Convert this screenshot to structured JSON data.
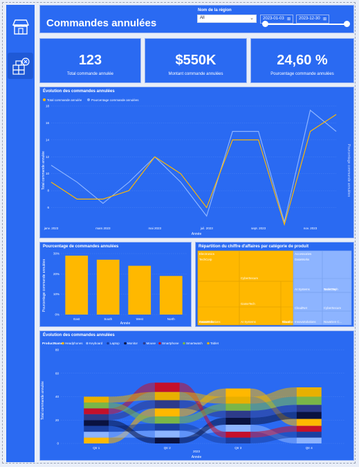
{
  "header": {
    "title": "Commandes annulées",
    "region_label": "Nom de la région",
    "region_value": "All",
    "date_start": "2023-01-03",
    "date_end": "2023-12-30"
  },
  "kpis": [
    {
      "value": "123",
      "label": "Total commande annulée"
    },
    {
      "value": "$550K",
      "label": "Montant commande annulées"
    },
    {
      "value": "24,60 %",
      "label": "Pourcentage commande annulées"
    }
  ],
  "colors": {
    "accent": "#2a6af2",
    "orange": "#ffb800",
    "light_blue": "#8db4ff"
  },
  "sidebar": {
    "icons": [
      "store-icon",
      "cancelled-boxes-icon"
    ]
  },
  "charts": {
    "line": {
      "title": "Évolution des commandes annulées",
      "legend": [
        "Total commande annulée",
        "Pourcentage commande annulées"
      ],
      "ylabel": "Total commande annulée",
      "y2label": "Pourcentage commande annulées",
      "xlabel": "Année",
      "ticks_x": [
        "janv. 2023",
        "mars 2023",
        "mai 2023",
        "juil. 2023",
        "sept. 2023",
        "nov. 2023"
      ],
      "ticks_y": [
        "6",
        "8",
        "10",
        "12",
        "14",
        "16",
        "18"
      ]
    },
    "bar": {
      "title": "Pourcentage de commandes annulées",
      "ylabel": "Pourcentage commande annulées",
      "xlabel": "Année",
      "ticks_y": [
        "0%",
        "10%",
        "20%",
        "30%"
      ]
    },
    "treemap": {
      "title": "Répartition du chiffre d'affaires par catégorie de produit"
    },
    "sankey": {
      "title": "Évolution des commandes annulées",
      "legend_label": "ProductName",
      "ylabel": "Total commande annulée",
      "xlabel": "Année",
      "year": "2023",
      "ticks_y": [
        "0",
        "20",
        "40",
        "60",
        "80"
      ],
      "quarters": [
        "Qtr 1",
        "Qtr 2",
        "Qtr 3",
        "Qtr 4"
      ]
    }
  },
  "chart_data": [
    {
      "type": "line",
      "title": "Évolution des commandes annulées",
      "xlabel": "Année",
      "ylabel": "Total commande annulée",
      "x": [
        "janv. 2023",
        "févr. 2023",
        "mars 2023",
        "avr. 2023",
        "mai 2023",
        "juin 2023",
        "juil. 2023",
        "août 2023",
        "sept. 2023",
        "oct. 2023",
        "nov. 2023",
        "déc. 2023"
      ],
      "ylim": [
        4,
        18
      ],
      "series": [
        {
          "name": "Total commande annulée",
          "color": "#ffb800",
          "values": [
            9,
            7,
            7,
            8,
            12,
            10,
            6,
            14,
            14,
            4,
            15,
            17
          ]
        },
        {
          "name": "Pourcentage commande annulées",
          "color": "#8db4ff",
          "values": [
            11,
            9,
            6.5,
            9,
            12,
            9,
            5,
            15,
            15,
            4.3,
            17.5,
            15
          ]
        }
      ]
    },
    {
      "type": "bar",
      "title": "Pourcentage de commandes annulées",
      "xlabel": "Année",
      "ylabel": "Pourcentage commande annulées",
      "categories": [
        "East",
        "South",
        "West",
        "North"
      ],
      "values": [
        29,
        27,
        24,
        19
      ],
      "ylim": [
        0,
        30
      ]
    },
    {
      "type": "treemap",
      "title": "Répartition du chiffre d'affaires par catégorie de produit",
      "groups": [
        {
          "name": "Electronics",
          "children": [
            "TechCorp",
            "CyberSecure",
            "DataWorks",
            "GameTech",
            "NovaGen Consulting",
            "AI Systems",
            "InnovaSolutions",
            "Cloud..."
          ]
        },
        {
          "name": "Accessories",
          "children": [
            "DataWorks",
            "GameTech",
            "CloudNet",
            "CyberSecure",
            "InnovaSolutions",
            "NovaGen C...",
            "AI Systems",
            "TechCorp"
          ]
        }
      ]
    },
    {
      "type": "sankey",
      "title": "Évolution des commandes annulées",
      "xlabel": "Année",
      "ylabel": "Total commande annulée",
      "categories": [
        "Qtr 1",
        "Qtr 2",
        "Qtr 3",
        "Qtr 4"
      ],
      "ylim": [
        0,
        80
      ],
      "series": [
        {
          "name": "Headphones",
          "color": "#ffb800",
          "values": [
            5,
            7,
            7,
            6
          ]
        },
        {
          "name": "Keyboard",
          "color": "#8db4ff",
          "values": [
            5,
            6,
            6,
            5
          ]
        },
        {
          "name": "Laptop",
          "color": "#1a3fa0",
          "values": [
            5,
            6,
            5,
            5
          ]
        },
        {
          "name": "Monitor",
          "color": "#0a1240",
          "values": [
            5,
            5,
            6,
            6
          ]
        },
        {
          "name": "Mouse",
          "color": "#2d3b8a",
          "values": [
            5,
            7,
            6,
            6
          ]
        },
        {
          "name": "Smartphone",
          "color": "#c4102a",
          "values": [
            5,
            8,
            5,
            5
          ]
        },
        {
          "name": "Smartwatch",
          "color": "#7ab648",
          "values": [
            5,
            6,
            6,
            7
          ]
        },
        {
          "name": "Tablet",
          "color": "#e8b000",
          "values": [
            5,
            7,
            6,
            8
          ]
        }
      ]
    }
  ]
}
